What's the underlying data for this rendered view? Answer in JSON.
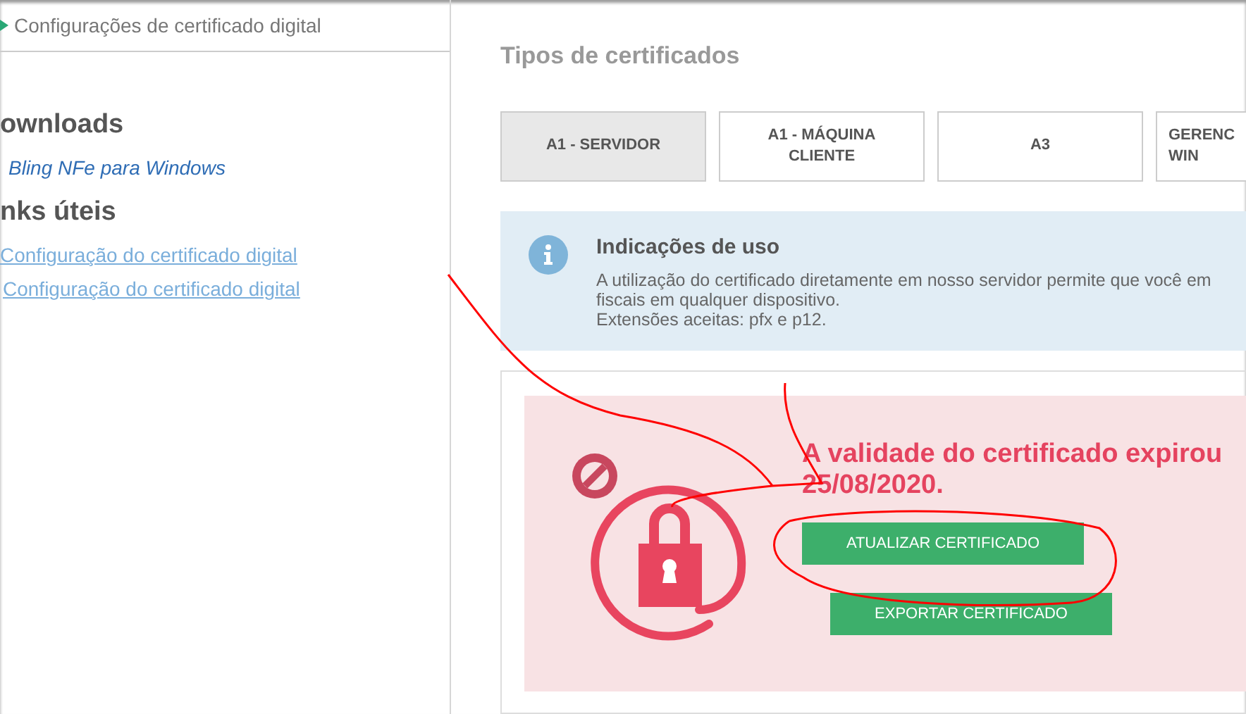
{
  "breadcrumb": "Configurações de certificado digital",
  "sidebar": {
    "sections": [
      {
        "title": "ownloads",
        "kind": "downloads",
        "links": [
          "Bling NFe para Windows"
        ]
      },
      {
        "title": "nks úteis",
        "kind": "links",
        "links": [
          "Configuração do certificado digital",
          "Configuração do certificado digital"
        ]
      }
    ]
  },
  "main": {
    "title": "Tipos de certificados",
    "tabs": [
      {
        "label": "A1 - SERVIDOR",
        "selected": true
      },
      {
        "label": "A1 - MÁQUINA CLIENTE",
        "selected": false
      },
      {
        "label": "A3",
        "selected": false
      },
      {
        "label": "GERENC\nWIN",
        "selected": false
      }
    ],
    "info": {
      "title": "Indicações de uso",
      "lines": [
        "A utilização do certificado diretamente em nosso servidor permite que você em",
        "fiscais em qualquer dispositivo.",
        "Extensões aceitas: pfx e p12."
      ]
    },
    "alert": {
      "message_lines": [
        "A validade do certificado expirou",
        "25/08/2020."
      ],
      "buttons": [
        "ATUALIZAR CERTIFICADO",
        "EXPORTAR CERTIFICADO"
      ]
    }
  }
}
